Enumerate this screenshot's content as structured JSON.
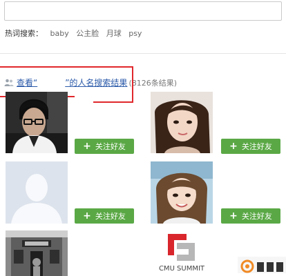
{
  "search": {
    "value": ""
  },
  "hot_search": {
    "label": "热词搜索：",
    "terms": [
      "baby",
      "公主脸",
      "月球",
      "psy"
    ]
  },
  "results": {
    "link_prefix": "查看“",
    "link_suffix": "”的人名搜索结果",
    "count": "(8126条结果)"
  },
  "follow_label": "关注好友",
  "logo_text": "CMU SUMMIT",
  "colors": {
    "accent": "#5aa845",
    "link": "#2b5aa9",
    "annotation": "#e0272b"
  }
}
